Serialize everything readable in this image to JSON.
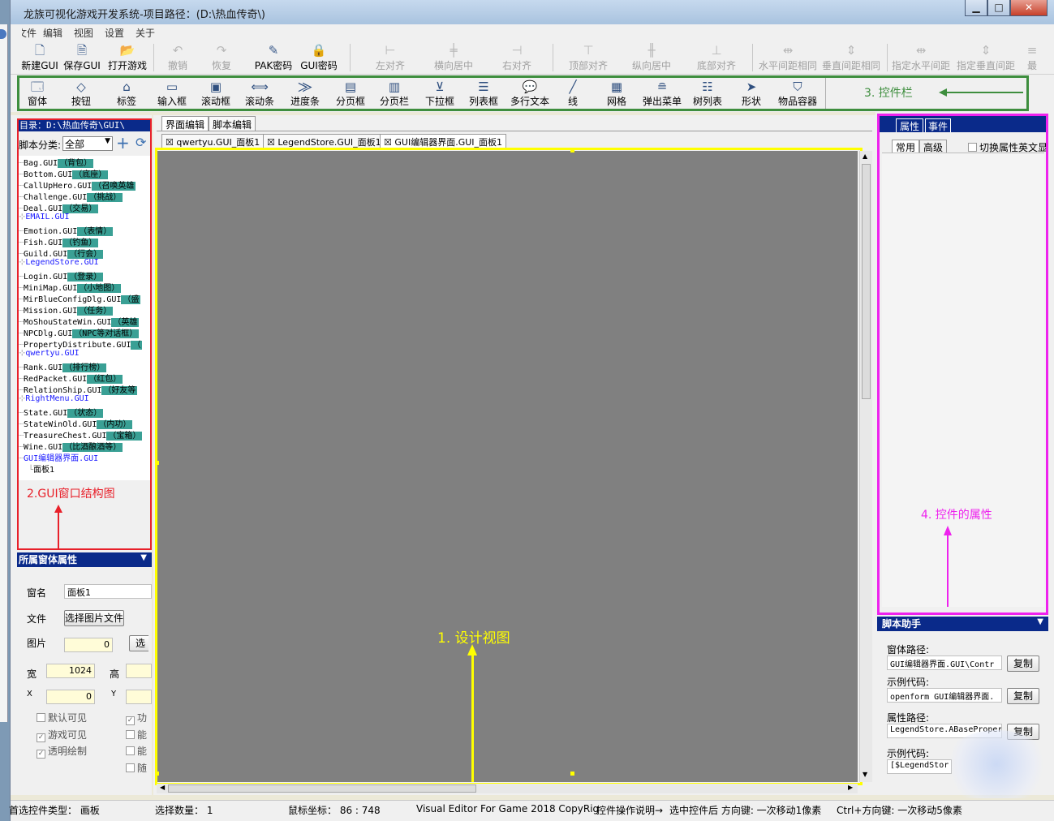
{
  "window": {
    "title": "龙族可视化游戏开发系统-项目路径：(D:\\热血传奇\\)",
    "min_label": "▁",
    "max_label": "□",
    "close_label": "✕"
  },
  "menu": [
    "文件",
    "编辑",
    "视图",
    "设置",
    "关于"
  ],
  "toolbar_main": [
    {
      "label": "新建GUI",
      "icon": "new-file-icon",
      "enabled": true
    },
    {
      "label": "保存GUI",
      "icon": "save-file-icon",
      "enabled": true
    },
    {
      "label": "打开游戏",
      "icon": "open-game-icon",
      "enabled": true
    },
    {
      "label": "撤销",
      "icon": "undo-icon",
      "enabled": false
    },
    {
      "label": "恢复",
      "icon": "redo-icon",
      "enabled": false
    },
    {
      "label": "PAK密码",
      "icon": "pak-password-icon",
      "enabled": true
    },
    {
      "label": "GUI密码",
      "icon": "lock-icon",
      "enabled": true
    },
    {
      "label": "左对齐",
      "icon": "align-left-icon",
      "enabled": false
    },
    {
      "label": "横向居中",
      "icon": "center-horizontal-icon",
      "enabled": false
    },
    {
      "label": "右对齐",
      "icon": "align-right-icon",
      "enabled": false
    },
    {
      "label": "顶部对齐",
      "icon": "align-top-icon",
      "enabled": false
    },
    {
      "label": "纵向居中",
      "icon": "center-vertical-icon",
      "enabled": false
    },
    {
      "label": "底部对齐",
      "icon": "align-bottom-icon",
      "enabled": false
    },
    {
      "label": "水平间距相同",
      "icon": "equal-hspacing-icon",
      "enabled": false
    },
    {
      "label": "垂直间距相同",
      "icon": "equal-vspacing-icon",
      "enabled": false
    },
    {
      "label": "指定水平间距",
      "icon": "set-hspacing-icon",
      "enabled": false
    },
    {
      "label": "指定垂直间距",
      "icon": "set-vspacing-icon",
      "enabled": false
    },
    {
      "label": "最",
      "icon": "more-icon",
      "enabled": false
    }
  ],
  "toolbar_controls": [
    {
      "label": "窗体",
      "icon": "form-icon"
    },
    {
      "label": "按钮",
      "icon": "button-icon"
    },
    {
      "label": "标签",
      "icon": "label-icon"
    },
    {
      "label": "输入框",
      "icon": "input-box-icon"
    },
    {
      "label": "滚动框",
      "icon": "scroll-box-icon"
    },
    {
      "label": "滚动条",
      "icon": "scrollbar-icon"
    },
    {
      "label": "进度条",
      "icon": "progress-bar-icon"
    },
    {
      "label": "分页框",
      "icon": "page-box-icon"
    },
    {
      "label": "分页栏",
      "icon": "page-bar-icon"
    },
    {
      "label": "下拉框",
      "icon": "dropdown-icon"
    },
    {
      "label": "列表框",
      "icon": "listbox-icon"
    },
    {
      "label": "多行文本",
      "icon": "multiline-text-icon"
    },
    {
      "label": "线",
      "icon": "line-icon"
    },
    {
      "label": "网格",
      "icon": "grid-icon"
    },
    {
      "label": "弹出菜单",
      "icon": "popup-menu-icon"
    },
    {
      "label": "树列表",
      "icon": "tree-list-icon"
    },
    {
      "label": "形状",
      "icon": "shape-icon"
    },
    {
      "label": "物品容器",
      "icon": "item-container-icon"
    }
  ],
  "left": {
    "dir_header": "目录：D:\\热血传奇\\GUI\\",
    "script_category_label": "脚本分类:",
    "script_category_value": "全部",
    "tree": [
      {
        "name": "Bag.GUI",
        "tag": "（背包）",
        "blue": false
      },
      {
        "name": "Bottom.GUI",
        "tag": "（底座）",
        "blue": false
      },
      {
        "name": "CallUpHero.GUI",
        "tag": "（召唤英雄",
        "blue": false
      },
      {
        "name": "Challenge.GUI",
        "tag": "（挑战）",
        "blue": false
      },
      {
        "name": "Deal.GUI",
        "tag": "（交易）",
        "blue": false
      },
      {
        "name": "EMAIL.GUI",
        "tag": "",
        "blue": true
      },
      {
        "name": "Emotion.GUI",
        "tag": "（表情）",
        "blue": false
      },
      {
        "name": "Fish.GUI",
        "tag": "（钓鱼）",
        "blue": false
      },
      {
        "name": "Guild.GUI",
        "tag": "（行会）",
        "blue": false
      },
      {
        "name": "LegendStore.GUI",
        "tag": "",
        "blue": true
      },
      {
        "name": "Login.GUI",
        "tag": "（登录）",
        "blue": false
      },
      {
        "name": "MiniMap.GUI",
        "tag": "（小地图）",
        "blue": false
      },
      {
        "name": "MirBlueConfigDlg.GUI",
        "tag": "（盛",
        "blue": false
      },
      {
        "name": "Mission.GUI",
        "tag": "（任务）",
        "blue": false
      },
      {
        "name": "MoShouStateWin.GUI",
        "tag": "（英雄",
        "blue": false
      },
      {
        "name": "NPCDlg.GUI",
        "tag": "（NPC等对话框）",
        "blue": false
      },
      {
        "name": "PropertyDistribute.GUI",
        "tag": "（",
        "blue": false
      },
      {
        "name": "qwertyu.GUI",
        "tag": "",
        "blue": true
      },
      {
        "name": "Rank.GUI",
        "tag": "（排行榜）",
        "blue": false
      },
      {
        "name": "RedPacket.GUI",
        "tag": "（红包）",
        "blue": false
      },
      {
        "name": "RelationShip.GUI",
        "tag": "（好友等",
        "blue": false
      },
      {
        "name": "RightMenu.GUI",
        "tag": "",
        "blue": true
      },
      {
        "name": "State.GUI",
        "tag": "（状态）",
        "blue": false
      },
      {
        "name": "StateWinOld.GUI",
        "tag": "（内功）",
        "blue": false
      },
      {
        "name": "TreasureChest.GUI",
        "tag": "（宝箱）",
        "blue": false
      },
      {
        "name": "Wine.GUI",
        "tag": "（比酒酿酒等）",
        "blue": false
      },
      {
        "name": "GUI编辑器界面.GUI",
        "tag": "",
        "blue": true
      }
    ],
    "tree_child": "面板1",
    "annotation": "2.GUI窗口结构图",
    "props_header": "所属窗体属性",
    "props": {
      "name_label": "窗名",
      "name_value": "面板1",
      "file_label": "文件",
      "file_button": "选择图片文件",
      "image_label": "图片",
      "image_value": "0",
      "select_button": "选",
      "width_label": "宽",
      "width_value": "1024",
      "height_label": "高",
      "x_label": "X",
      "x_value": "0",
      "y_label": "Y",
      "chk_default_visible": "默认可见",
      "chk_game_visible": "游戏可见",
      "chk_transparent": "透明绘制",
      "chk_r1": "功",
      "chk_r2": "能",
      "chk_r3": "能",
      "chk_r4": "随"
    }
  },
  "center": {
    "mode_tabs": [
      "界面编辑",
      "脚本编辑"
    ],
    "doc_tabs": [
      "qwertyu.GUI_面板1",
      "LegendStore.GUI_面板1",
      "GUI编辑器界面.GUI_面板1"
    ],
    "annotation": "1. 设计视图"
  },
  "right": {
    "tabs": [
      "属性",
      "事件"
    ],
    "subtabs": [
      "常用",
      "高级"
    ],
    "toggle_label": "切换属性英文显",
    "annotation": "4. 控件的属性",
    "script_header": "脚本助手",
    "form_path_label": "窗体路径:",
    "form_path_value": "GUI编辑器界面.GUI\\Contr",
    "example1_label": "示例代码:",
    "example1_value": "openform GUI编辑器界面.",
    "prop_path_label": "属性路径:",
    "prop_path_value": "LegendStore.ABasePropert",
    "example2_label": "示例代码:",
    "example2_value": "[$LegendStor",
    "copy_label": "复制",
    "copy_label_partial": "复制"
  },
  "toolbar_annotation": "3. 控件栏",
  "status": {
    "type": "首选控件类型： 画板",
    "count": "选择数量： 1",
    "mouse": "鼠标坐标： 86 : 748",
    "copyright": "Visual Editor For Game 2018 CopyRig",
    "hint1": "控件操作说明→",
    "hint2": "选中控件后 方向键: 一次移动1像素",
    "hint3": "Ctrl+方向键: 一次移动5像素"
  },
  "colors": {
    "toolbar_frame": "#3e8e3e",
    "tree_frame": "#e8202a",
    "canvas_frame": "#ffff00",
    "prop_frame": "#ee22ee",
    "canvas_bg": "#808080",
    "panel_header": "#0a2a8a"
  }
}
